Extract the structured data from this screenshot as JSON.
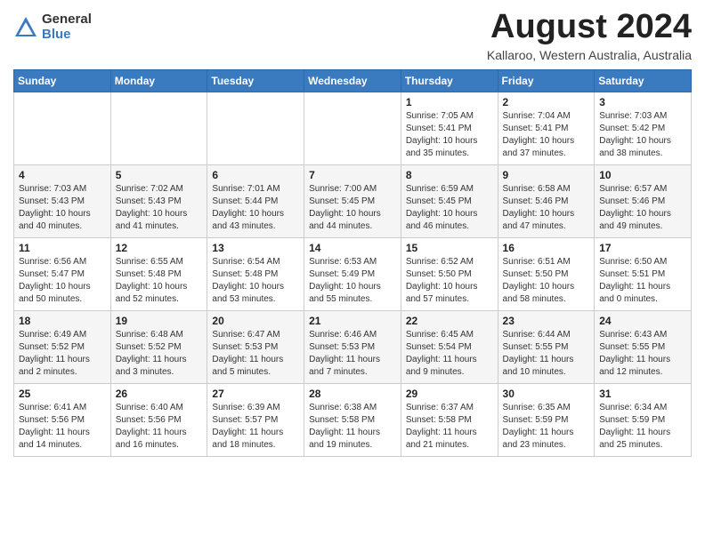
{
  "header": {
    "logo_general": "General",
    "logo_blue": "Blue",
    "month_year": "August 2024",
    "location": "Kallaroo, Western Australia, Australia"
  },
  "days_of_week": [
    "Sunday",
    "Monday",
    "Tuesday",
    "Wednesday",
    "Thursday",
    "Friday",
    "Saturday"
  ],
  "weeks": [
    [
      {
        "num": "",
        "info": ""
      },
      {
        "num": "",
        "info": ""
      },
      {
        "num": "",
        "info": ""
      },
      {
        "num": "",
        "info": ""
      },
      {
        "num": "1",
        "info": "Sunrise: 7:05 AM\nSunset: 5:41 PM\nDaylight: 10 hours\nand 35 minutes."
      },
      {
        "num": "2",
        "info": "Sunrise: 7:04 AM\nSunset: 5:41 PM\nDaylight: 10 hours\nand 37 minutes."
      },
      {
        "num": "3",
        "info": "Sunrise: 7:03 AM\nSunset: 5:42 PM\nDaylight: 10 hours\nand 38 minutes."
      }
    ],
    [
      {
        "num": "4",
        "info": "Sunrise: 7:03 AM\nSunset: 5:43 PM\nDaylight: 10 hours\nand 40 minutes."
      },
      {
        "num": "5",
        "info": "Sunrise: 7:02 AM\nSunset: 5:43 PM\nDaylight: 10 hours\nand 41 minutes."
      },
      {
        "num": "6",
        "info": "Sunrise: 7:01 AM\nSunset: 5:44 PM\nDaylight: 10 hours\nand 43 minutes."
      },
      {
        "num": "7",
        "info": "Sunrise: 7:00 AM\nSunset: 5:45 PM\nDaylight: 10 hours\nand 44 minutes."
      },
      {
        "num": "8",
        "info": "Sunrise: 6:59 AM\nSunset: 5:45 PM\nDaylight: 10 hours\nand 46 minutes."
      },
      {
        "num": "9",
        "info": "Sunrise: 6:58 AM\nSunset: 5:46 PM\nDaylight: 10 hours\nand 47 minutes."
      },
      {
        "num": "10",
        "info": "Sunrise: 6:57 AM\nSunset: 5:46 PM\nDaylight: 10 hours\nand 49 minutes."
      }
    ],
    [
      {
        "num": "11",
        "info": "Sunrise: 6:56 AM\nSunset: 5:47 PM\nDaylight: 10 hours\nand 50 minutes."
      },
      {
        "num": "12",
        "info": "Sunrise: 6:55 AM\nSunset: 5:48 PM\nDaylight: 10 hours\nand 52 minutes."
      },
      {
        "num": "13",
        "info": "Sunrise: 6:54 AM\nSunset: 5:48 PM\nDaylight: 10 hours\nand 53 minutes."
      },
      {
        "num": "14",
        "info": "Sunrise: 6:53 AM\nSunset: 5:49 PM\nDaylight: 10 hours\nand 55 minutes."
      },
      {
        "num": "15",
        "info": "Sunrise: 6:52 AM\nSunset: 5:50 PM\nDaylight: 10 hours\nand 57 minutes."
      },
      {
        "num": "16",
        "info": "Sunrise: 6:51 AM\nSunset: 5:50 PM\nDaylight: 10 hours\nand 58 minutes."
      },
      {
        "num": "17",
        "info": "Sunrise: 6:50 AM\nSunset: 5:51 PM\nDaylight: 11 hours\nand 0 minutes."
      }
    ],
    [
      {
        "num": "18",
        "info": "Sunrise: 6:49 AM\nSunset: 5:52 PM\nDaylight: 11 hours\nand 2 minutes."
      },
      {
        "num": "19",
        "info": "Sunrise: 6:48 AM\nSunset: 5:52 PM\nDaylight: 11 hours\nand 3 minutes."
      },
      {
        "num": "20",
        "info": "Sunrise: 6:47 AM\nSunset: 5:53 PM\nDaylight: 11 hours\nand 5 minutes."
      },
      {
        "num": "21",
        "info": "Sunrise: 6:46 AM\nSunset: 5:53 PM\nDaylight: 11 hours\nand 7 minutes."
      },
      {
        "num": "22",
        "info": "Sunrise: 6:45 AM\nSunset: 5:54 PM\nDaylight: 11 hours\nand 9 minutes."
      },
      {
        "num": "23",
        "info": "Sunrise: 6:44 AM\nSunset: 5:55 PM\nDaylight: 11 hours\nand 10 minutes."
      },
      {
        "num": "24",
        "info": "Sunrise: 6:43 AM\nSunset: 5:55 PM\nDaylight: 11 hours\nand 12 minutes."
      }
    ],
    [
      {
        "num": "25",
        "info": "Sunrise: 6:41 AM\nSunset: 5:56 PM\nDaylight: 11 hours\nand 14 minutes."
      },
      {
        "num": "26",
        "info": "Sunrise: 6:40 AM\nSunset: 5:56 PM\nDaylight: 11 hours\nand 16 minutes."
      },
      {
        "num": "27",
        "info": "Sunrise: 6:39 AM\nSunset: 5:57 PM\nDaylight: 11 hours\nand 18 minutes."
      },
      {
        "num": "28",
        "info": "Sunrise: 6:38 AM\nSunset: 5:58 PM\nDaylight: 11 hours\nand 19 minutes."
      },
      {
        "num": "29",
        "info": "Sunrise: 6:37 AM\nSunset: 5:58 PM\nDaylight: 11 hours\nand 21 minutes."
      },
      {
        "num": "30",
        "info": "Sunrise: 6:35 AM\nSunset: 5:59 PM\nDaylight: 11 hours\nand 23 minutes."
      },
      {
        "num": "31",
        "info": "Sunrise: 6:34 AM\nSunset: 5:59 PM\nDaylight: 11 hours\nand 25 minutes."
      }
    ]
  ]
}
